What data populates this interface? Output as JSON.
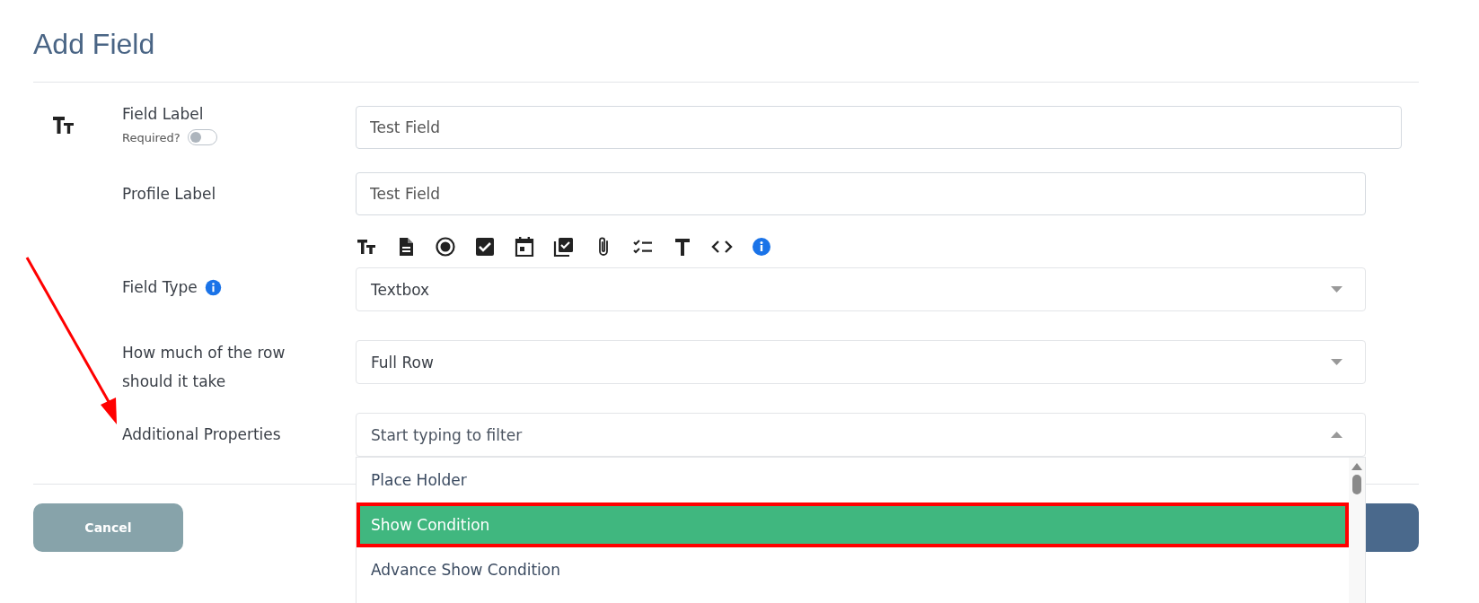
{
  "title": "Add Field",
  "field_label": {
    "label": "Field Label",
    "required": {
      "label": "Required?",
      "on": false
    },
    "value": "Test Field"
  },
  "profile_label": {
    "label": "Profile Label",
    "value": "Test Field"
  },
  "field_type": {
    "label": "Field Type",
    "value": "Textbox"
  },
  "width": {
    "label": "How much of the row should it take",
    "value": "Full Row"
  },
  "additional_properties": {
    "label": "Additional Properties",
    "placeholder": "Start typing to filter",
    "expanded": true,
    "options": [
      {
        "label": "Place Holder",
        "selected": false
      },
      {
        "label": "Show Condition",
        "selected": true
      },
      {
        "label": "Advance Show Condition",
        "selected": false
      }
    ]
  },
  "buttons": {
    "cancel": "Cancel"
  }
}
